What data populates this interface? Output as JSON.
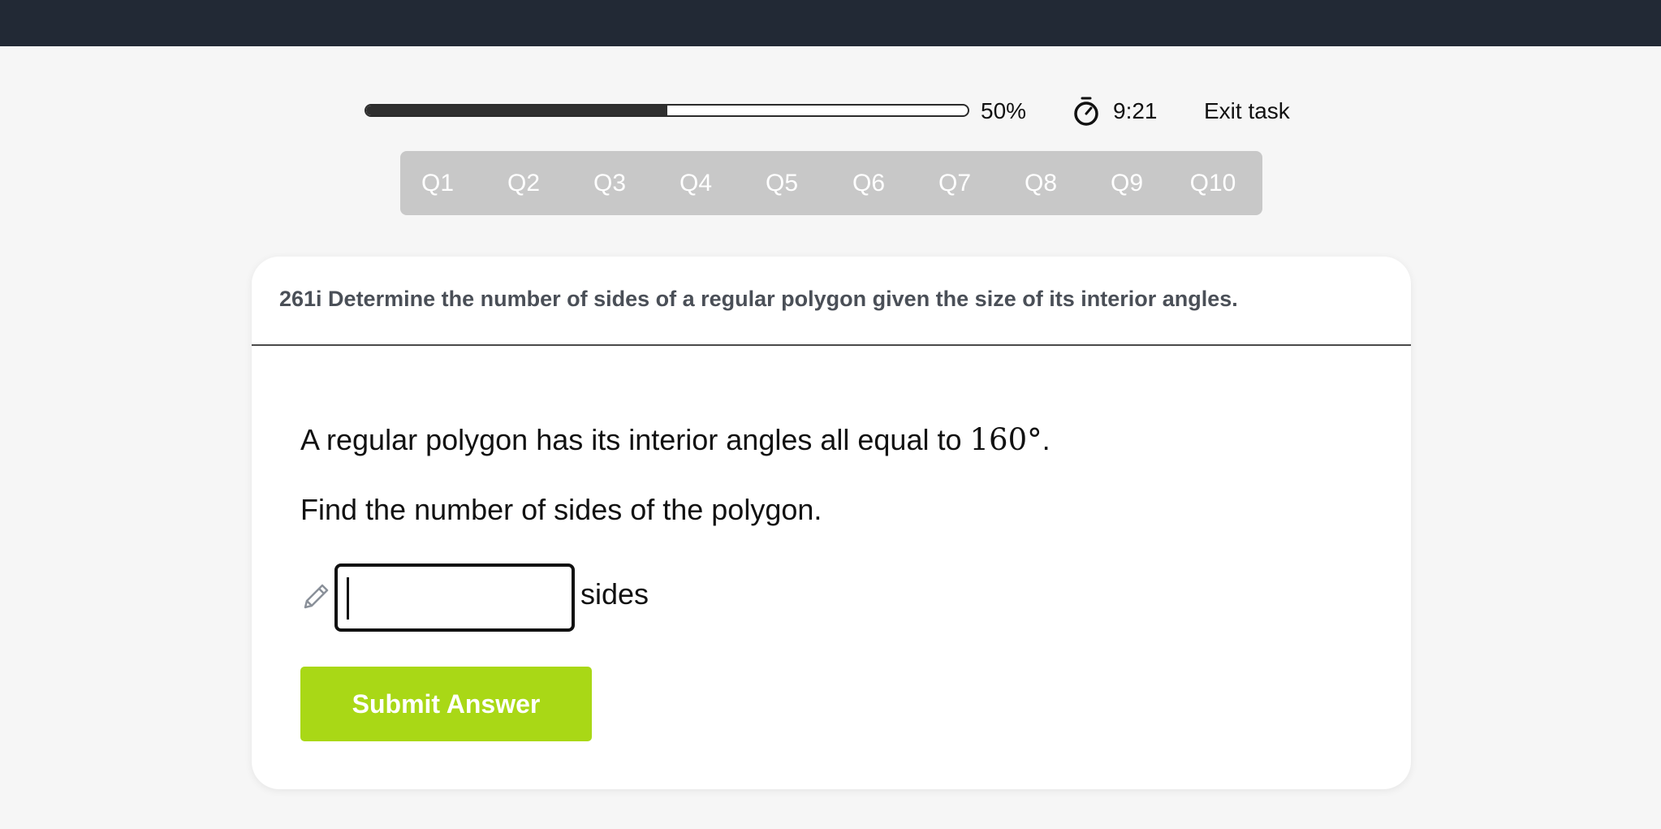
{
  "progress": {
    "percent_label": "50%",
    "fraction": 0.5
  },
  "timer": {
    "icon": "stopwatch-icon",
    "time": "9:21"
  },
  "exit_label": "Exit task",
  "question_tabs": [
    "Q1",
    "Q2",
    "Q3",
    "Q4",
    "Q5",
    "Q6",
    "Q7",
    "Q8",
    "Q9",
    "Q10"
  ],
  "card": {
    "title": "261i Determine the number of sides of a regular polygon given the size of its interior angles.",
    "prompt_text": "A regular polygon has its interior angles all equal to ",
    "prompt_angle": "160°",
    "prompt_end": ".",
    "instruction": "Find the number of sides of the polygon.",
    "answer_value": "",
    "answer_unit": "sides",
    "submit_label": "Submit Answer",
    "pencil_icon": "pencil-icon"
  },
  "colors": {
    "topbar": "#222935",
    "submit": "#a9d816",
    "tab_bar": "#c8c8c8"
  }
}
